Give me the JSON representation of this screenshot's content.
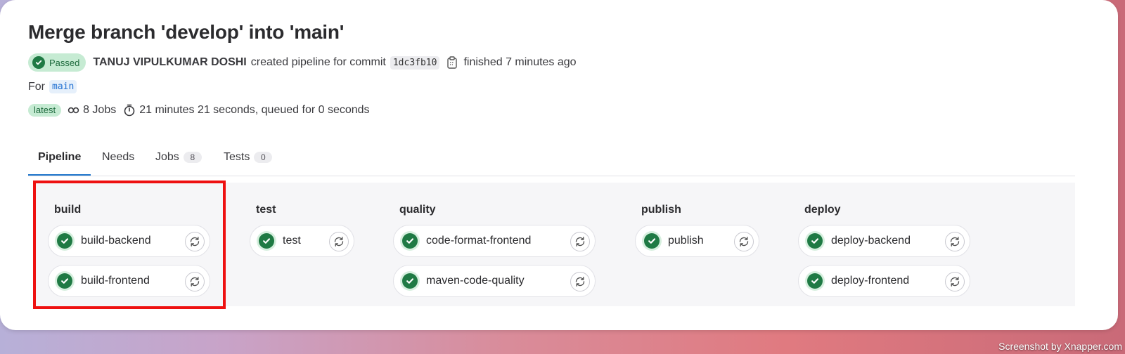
{
  "pipeline_title": "Merge branch 'develop' into 'main'",
  "status": {
    "label": "Passed",
    "color": "#1f7a44"
  },
  "author": "TANUJ VIPULKUMAR DOSHI",
  "created_text": "created pipeline for commit",
  "commit_sha": "1dc3fb10",
  "finished_text": "finished 7 minutes ago",
  "for_label": "For",
  "branch": "main",
  "latest_badge": "latest",
  "jobs_text": "8 Jobs",
  "duration_text": "21 minutes 21 seconds, queued for 0 seconds",
  "tabs": [
    {
      "label": "Pipeline",
      "active": true
    },
    {
      "label": "Needs"
    },
    {
      "label": "Jobs",
      "count": "8"
    },
    {
      "label": "Tests",
      "count": "0"
    }
  ],
  "stages": [
    {
      "name": "build",
      "jobs": [
        "build-backend",
        "build-frontend"
      ]
    },
    {
      "name": "test",
      "jobs": [
        "test"
      ]
    },
    {
      "name": "quality",
      "jobs": [
        "code-format-frontend",
        "maven-code-quality"
      ]
    },
    {
      "name": "publish",
      "jobs": [
        "publish"
      ]
    },
    {
      "name": "deploy",
      "jobs": [
        "deploy-backend",
        "deploy-frontend"
      ]
    }
  ],
  "accent_color": "#1f75cb",
  "highlight_color": "#ee1111",
  "watermark": "Screenshot by Xnapper.com"
}
